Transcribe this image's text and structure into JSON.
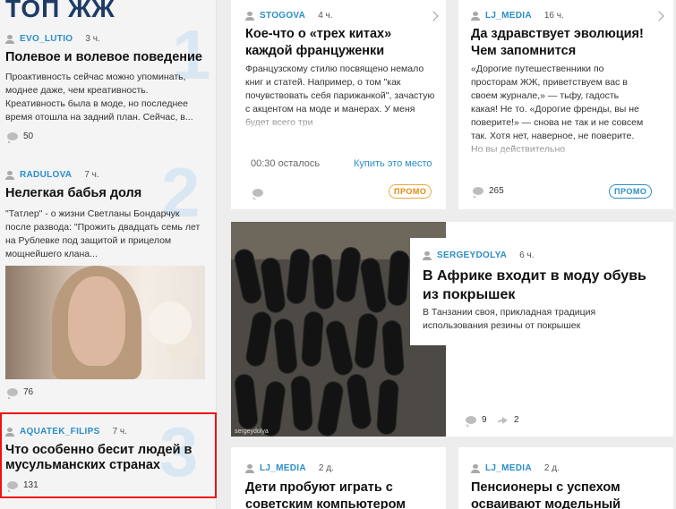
{
  "left": {
    "title": "ТОП ЖЖ",
    "items": [
      {
        "rank": "1",
        "author": "EVO_LUTIO",
        "time": "3 ч.",
        "title": "Полевое и волевое поведение",
        "text": "Проактивность сейчас можно упоминать, моднее даже, чем креативность. Креативность была в моде, но последнее время отошла на задний план. Сейчас, в...",
        "comments": "50"
      },
      {
        "rank": "2",
        "author": "RADULOVA",
        "time": "7 ч.",
        "title": "Нелегкая бабья доля",
        "text": "\"Татлер\" - о жизни Светланы Бондарчук после развода: \"Прожить двадцать семь лет на Рублевке под защитой и прицелом мощнейшего клана...",
        "comments": "76"
      },
      {
        "rank": "3",
        "author": "AQUATEK_FILIPS",
        "time": "7 ч.",
        "title": "Что особенно бесит людей в мусульманских странах",
        "comments": "131"
      }
    ]
  },
  "cards": {
    "stogova": {
      "author": "STOGOVA",
      "time": "4 ч.",
      "title": "Кое-что о «трех китах» каждой француженки",
      "text": "Французскому стилю посвящено немало книг и статей. Например, о том \"как почувствовать себя парижанкой\", зачастую с акцентом на моде и манерах. У меня будет всего три",
      "remaining": "00:30 осталось",
      "buy": "Купить это место",
      "promo": "ПРОМО"
    },
    "ljmedia1": {
      "author": "LJ_MEDIA",
      "time": "16 ч.",
      "title": "Да здравствует эволюция! Чем запомнится",
      "text": "«Дорогие путешественники по просторам ЖЖ, приветствуем вас в своем журнале,» — тьфу, гадость какая! Не то. «Дорогие френды, вы не поверите!» — снова не так и не совсем так. Хотя нет, наверное, не поверите. Но вы действительно",
      "comments": "265",
      "promo": "ПРОМО"
    },
    "africa": {
      "author": "SERGEYDOLYA",
      "time": "6 ч.",
      "title": "В Африке входит в моду обувь из покрышек",
      "text": "В Танзании своя, прикладная традиция использования резины от покрышек",
      "comments": "9",
      "shares": "2",
      "photo_credit": "sergeydolya"
    },
    "ljmedia2": {
      "author": "LJ_MEDIA",
      "time": "2 д.",
      "title": "Дети пробуют играть с советским компьютером"
    },
    "ljmedia3": {
      "author": "LJ_MEDIA",
      "time": "2 д.",
      "title": "Пенсионеры с успехом осваивают модельный"
    }
  },
  "colors": {
    "accent": "#2a8ec8",
    "title_blue": "#1d3c66",
    "rank_numeral": "#d9e7f3",
    "promo_orange": "#f1a63a",
    "highlight_red": "#e11111"
  }
}
